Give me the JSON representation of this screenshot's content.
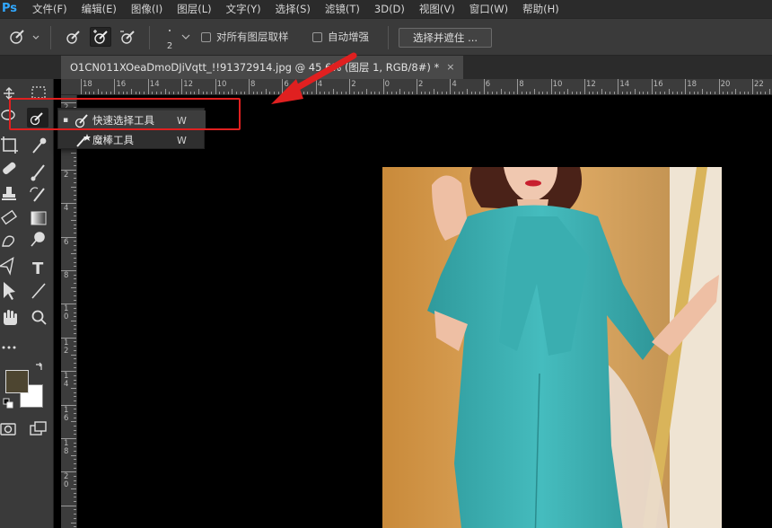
{
  "app": {
    "logo": "Ps"
  },
  "menu": [
    "文件(F)",
    "编辑(E)",
    "图像(I)",
    "图层(L)",
    "文字(Y)",
    "选择(S)",
    "滤镜(T)",
    "3D(D)",
    "视图(V)",
    "窗口(W)",
    "帮助(H)"
  ],
  "options": {
    "brush_size": "2",
    "sample_all_layers_label": "对所有图层取样",
    "auto_enhance_label": "自动增强",
    "select_mask_label": "选择并遮住 ..."
  },
  "tab": {
    "title": "O1CN011XOeaDmoDJiVqtt_!!91372914.jpg @ 45.6% (图层 1, RGB/8#) *",
    "close": "×"
  },
  "flyout": {
    "items": [
      {
        "bullet": "▪",
        "label": "快速选择工具",
        "shortcut": "W"
      },
      {
        "label": "魔棒工具",
        "shortcut": "W"
      }
    ]
  },
  "ruler": {
    "top": [
      "18",
      "16",
      "14",
      "12",
      "10",
      "8",
      "6",
      "4",
      "2",
      "0",
      "2",
      "4",
      "6",
      "8",
      "10",
      "12",
      "14",
      "16",
      "18",
      "20",
      "22"
    ],
    "left": [
      "2",
      "0",
      "2",
      "4",
      "6",
      "8",
      "1\n0",
      "1\n2",
      "1\n4",
      "1\n6",
      "1\n8",
      "2\n0"
    ]
  },
  "colors": {
    "foreground": "#4d4530",
    "background": "#ffffff",
    "annotation": "#e02020",
    "dress": "#3fb3b5"
  }
}
